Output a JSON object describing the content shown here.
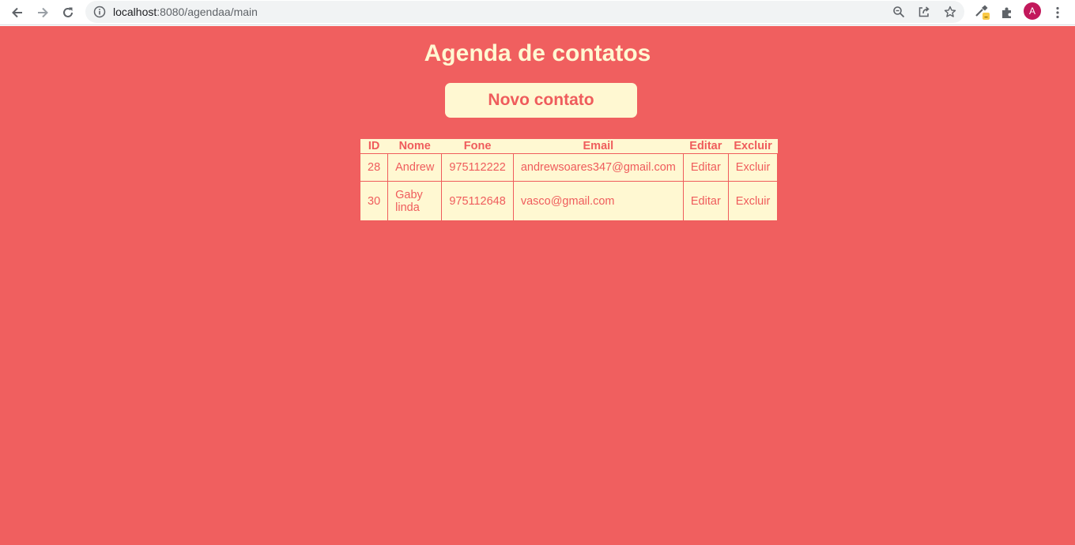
{
  "colors": {
    "page_bg": "#f05f5f",
    "cream": "#fff8d2",
    "accent": "#ef5c5c"
  },
  "browser": {
    "url_host": "localhost",
    "url_rest": ":8080/agendaa/main",
    "avatar_letter": "A",
    "icons": [
      "back-icon",
      "forward-icon",
      "reload-icon",
      "info-icon",
      "zoom-icon",
      "share-icon",
      "star-icon",
      "eyedropper-extension-icon",
      "extensions-puzzle-icon",
      "menu-kebab-icon"
    ]
  },
  "page": {
    "title": "Agenda de contatos",
    "new_contact_label": "Novo contato"
  },
  "table": {
    "headers": [
      "ID",
      "Nome",
      "Fone",
      "Email",
      "Editar",
      "Excluir"
    ],
    "rows": [
      {
        "id": "28",
        "nome": "Andrew",
        "fone": "975112222",
        "email": "andrewsoares347@gmail.com",
        "editar": "Editar",
        "excluir": "Excluir"
      },
      {
        "id": "30",
        "nome": "Gaby linda",
        "fone": "975112648",
        "email": "vasco@gmail.com",
        "editar": "Editar",
        "excluir": "Excluir"
      }
    ]
  }
}
